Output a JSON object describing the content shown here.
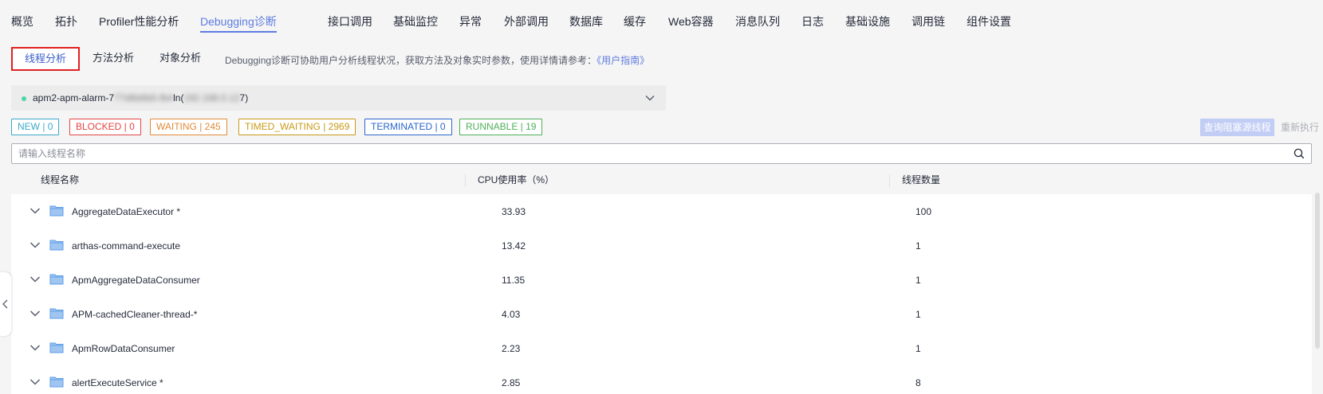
{
  "nav": {
    "items": [
      {
        "label": "概览",
        "active": false
      },
      {
        "label": "拓扑",
        "active": false
      },
      {
        "label": "Profiler性能分析",
        "active": false
      },
      {
        "label": "Debugging诊断",
        "active": true
      },
      {
        "label": "接口调用",
        "active": false
      },
      {
        "label": "基础监控",
        "active": false
      },
      {
        "label": "异常",
        "active": false
      },
      {
        "label": "外部调用",
        "active": false
      },
      {
        "label": "数据库",
        "active": false
      },
      {
        "label": "缓存",
        "active": false
      },
      {
        "label": "Web容器",
        "active": false
      },
      {
        "label": "消息队列",
        "active": false
      },
      {
        "label": "日志",
        "active": false
      },
      {
        "label": "基础设施",
        "active": false
      },
      {
        "label": "调用链",
        "active": false
      },
      {
        "label": "组件设置",
        "active": false
      }
    ]
  },
  "subtabs": {
    "items": [
      {
        "label": "线程分析",
        "active": true
      },
      {
        "label": "方法分析",
        "active": false
      },
      {
        "label": "对象分析",
        "active": false
      }
    ],
    "description": "Debugging诊断可协助用户分析线程状况，获取方法及对象实时参数，使用详情请参考：",
    "guide_link": "《用户指南》"
  },
  "instance": {
    "prefix": "apm2-apm-alarm-7",
    "masked_mid": "77d6b6b5-fb4",
    "mid_suffix": "ln(",
    "masked_ip": "192.168.0.12",
    "suffix": "7)",
    "status_color": "#50d4ab"
  },
  "states": [
    {
      "label": "NEW | 0",
      "color": "#3ba8c9"
    },
    {
      "label": "BLOCKED | 0",
      "color": "#e54545"
    },
    {
      "label": "WAITING | 245",
      "color": "#e08a38"
    },
    {
      "label": "TIMED_WAITING | 2969",
      "color": "#c89a18"
    },
    {
      "label": "TERMINATED | 0",
      "color": "#2a66cc"
    },
    {
      "label": "RUNNABLE | 19",
      "color": "#4db05b"
    }
  ],
  "actions": {
    "query_blocked": "查询阻塞源线程",
    "rerun": "重新执行"
  },
  "search": {
    "placeholder": "请输入线程名称",
    "value": ""
  },
  "table": {
    "columns": [
      "线程名称",
      "CPU使用率（%）",
      "线程数量"
    ],
    "rows": [
      {
        "name": "AggregateDataExecutor *",
        "cpu": "33.93",
        "count": "100"
      },
      {
        "name": "arthas-command-execute",
        "cpu": "13.42",
        "count": "1"
      },
      {
        "name": "ApmAggregateDataConsumer",
        "cpu": "11.35",
        "count": "1"
      },
      {
        "name": "APM-cachedCleaner-thread-*",
        "cpu": "4.03",
        "count": "1"
      },
      {
        "name": "ApmRowDataConsumer",
        "cpu": "2.23",
        "count": "1"
      },
      {
        "name": "alertExecuteService *",
        "cpu": "2.85",
        "count": "8"
      }
    ]
  },
  "icons": {
    "row_expand": "chevron-down-icon",
    "row_type": "folder-icon",
    "search": "search-icon",
    "select": "chevron-down-icon",
    "sidebar": "chevron-left-icon"
  },
  "colors": {
    "accent": "#5e7ce0",
    "active_outline": "#e02020",
    "folder": "#5e9ee8"
  }
}
